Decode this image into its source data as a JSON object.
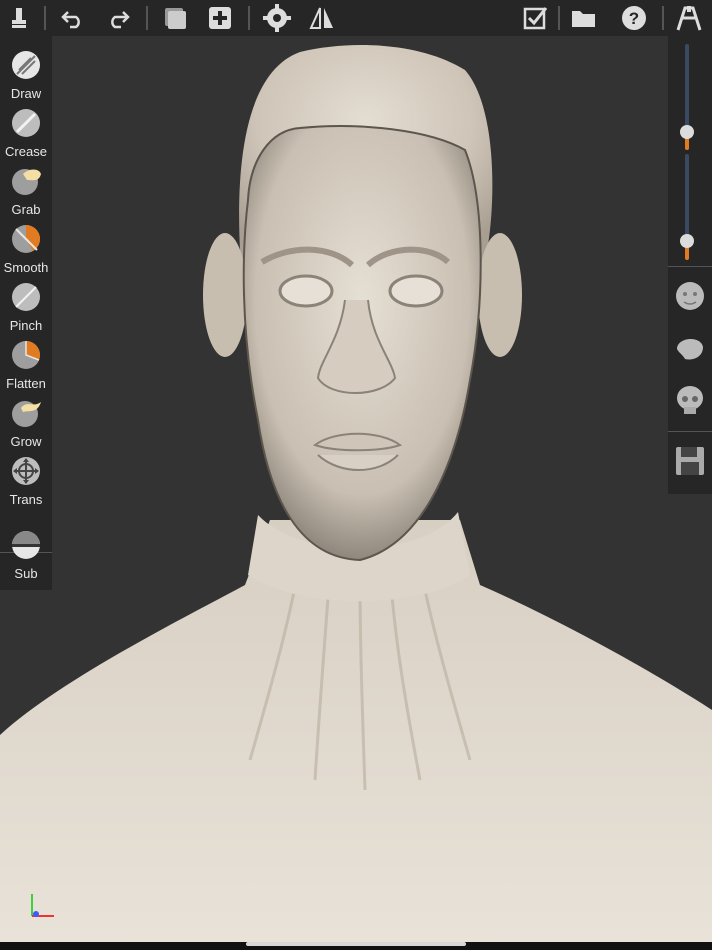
{
  "toolbar": {
    "icons": [
      "brush-icon",
      "undo-icon",
      "redo-icon",
      "layers-icon",
      "add-icon",
      "settings-icon",
      "symmetry-icon",
      "checkbox-icon",
      "folder-icon",
      "help-icon",
      "menu-icon"
    ]
  },
  "tools": [
    {
      "label": "Draw",
      "icon": "draw-tool-icon"
    },
    {
      "label": "Crease",
      "icon": "crease-tool-icon"
    },
    {
      "label": "Grab",
      "icon": "grab-tool-icon"
    },
    {
      "label": "Smooth",
      "icon": "smooth-tool-icon"
    },
    {
      "label": "Pinch",
      "icon": "pinch-tool-icon"
    },
    {
      "label": "Flatten",
      "icon": "flatten-tool-icon"
    },
    {
      "label": "Grow",
      "icon": "grow-tool-icon"
    },
    {
      "label": "Trans",
      "icon": "trans-tool-icon"
    },
    {
      "label": "Sub",
      "icon": "sub-tool-icon"
    }
  ],
  "right_panel": {
    "size_slider_value": 0.12,
    "strength_slider_value": 0.12,
    "buttons": [
      "head-preset-front-icon",
      "head-preset-side-icon",
      "head-preset-skull-icon",
      "save-icon"
    ]
  },
  "colors": {
    "background": "#333333",
    "panel": "#262626",
    "accent": "#e07b21",
    "clay": "#d6cdbf"
  }
}
